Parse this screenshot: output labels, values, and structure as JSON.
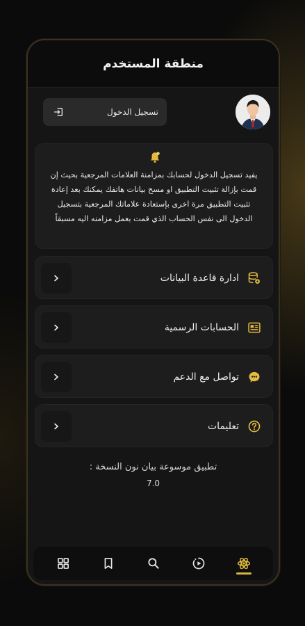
{
  "header": {
    "title": "منطقة المستخدم"
  },
  "user": {
    "login_label": "تسجيل الدخول"
  },
  "notice": {
    "text": "يفيد تسجيل الدخول لحسابك بمزامنة العلامات المرجعية بحيث إن قمت بإزالة تثبيت التطبيق او مسح بيانات هاتفك يمكنك بعد إعادة تثبيت التطبيق مرة اخرى بإستعادة علاماتك المرجعية بتسجيل الدخول الى نفس الحساب الذي قمت بعمل مزامنه اليه مسبقاً"
  },
  "menu": {
    "items": [
      {
        "label": "ادارة قاعدة البيانات",
        "icon": "database-settings-icon"
      },
      {
        "label": "الحسابات الرسمية",
        "icon": "official-accounts-icon"
      },
      {
        "label": "تواصل مع الدعم",
        "icon": "support-chat-icon"
      },
      {
        "label": "تعليمات",
        "icon": "help-icon"
      }
    ]
  },
  "version": {
    "title": "تطبيق موسوعة بيان نون النسخة :",
    "number": "7.0"
  },
  "nav": {
    "items": [
      "grid-icon",
      "bookmark-icon",
      "search-icon",
      "play-icon",
      "atom-icon"
    ],
    "active": "atom-icon"
  },
  "colors": {
    "accent": "#d9b33c",
    "background": "#151515",
    "card": "#1d1d1d"
  }
}
